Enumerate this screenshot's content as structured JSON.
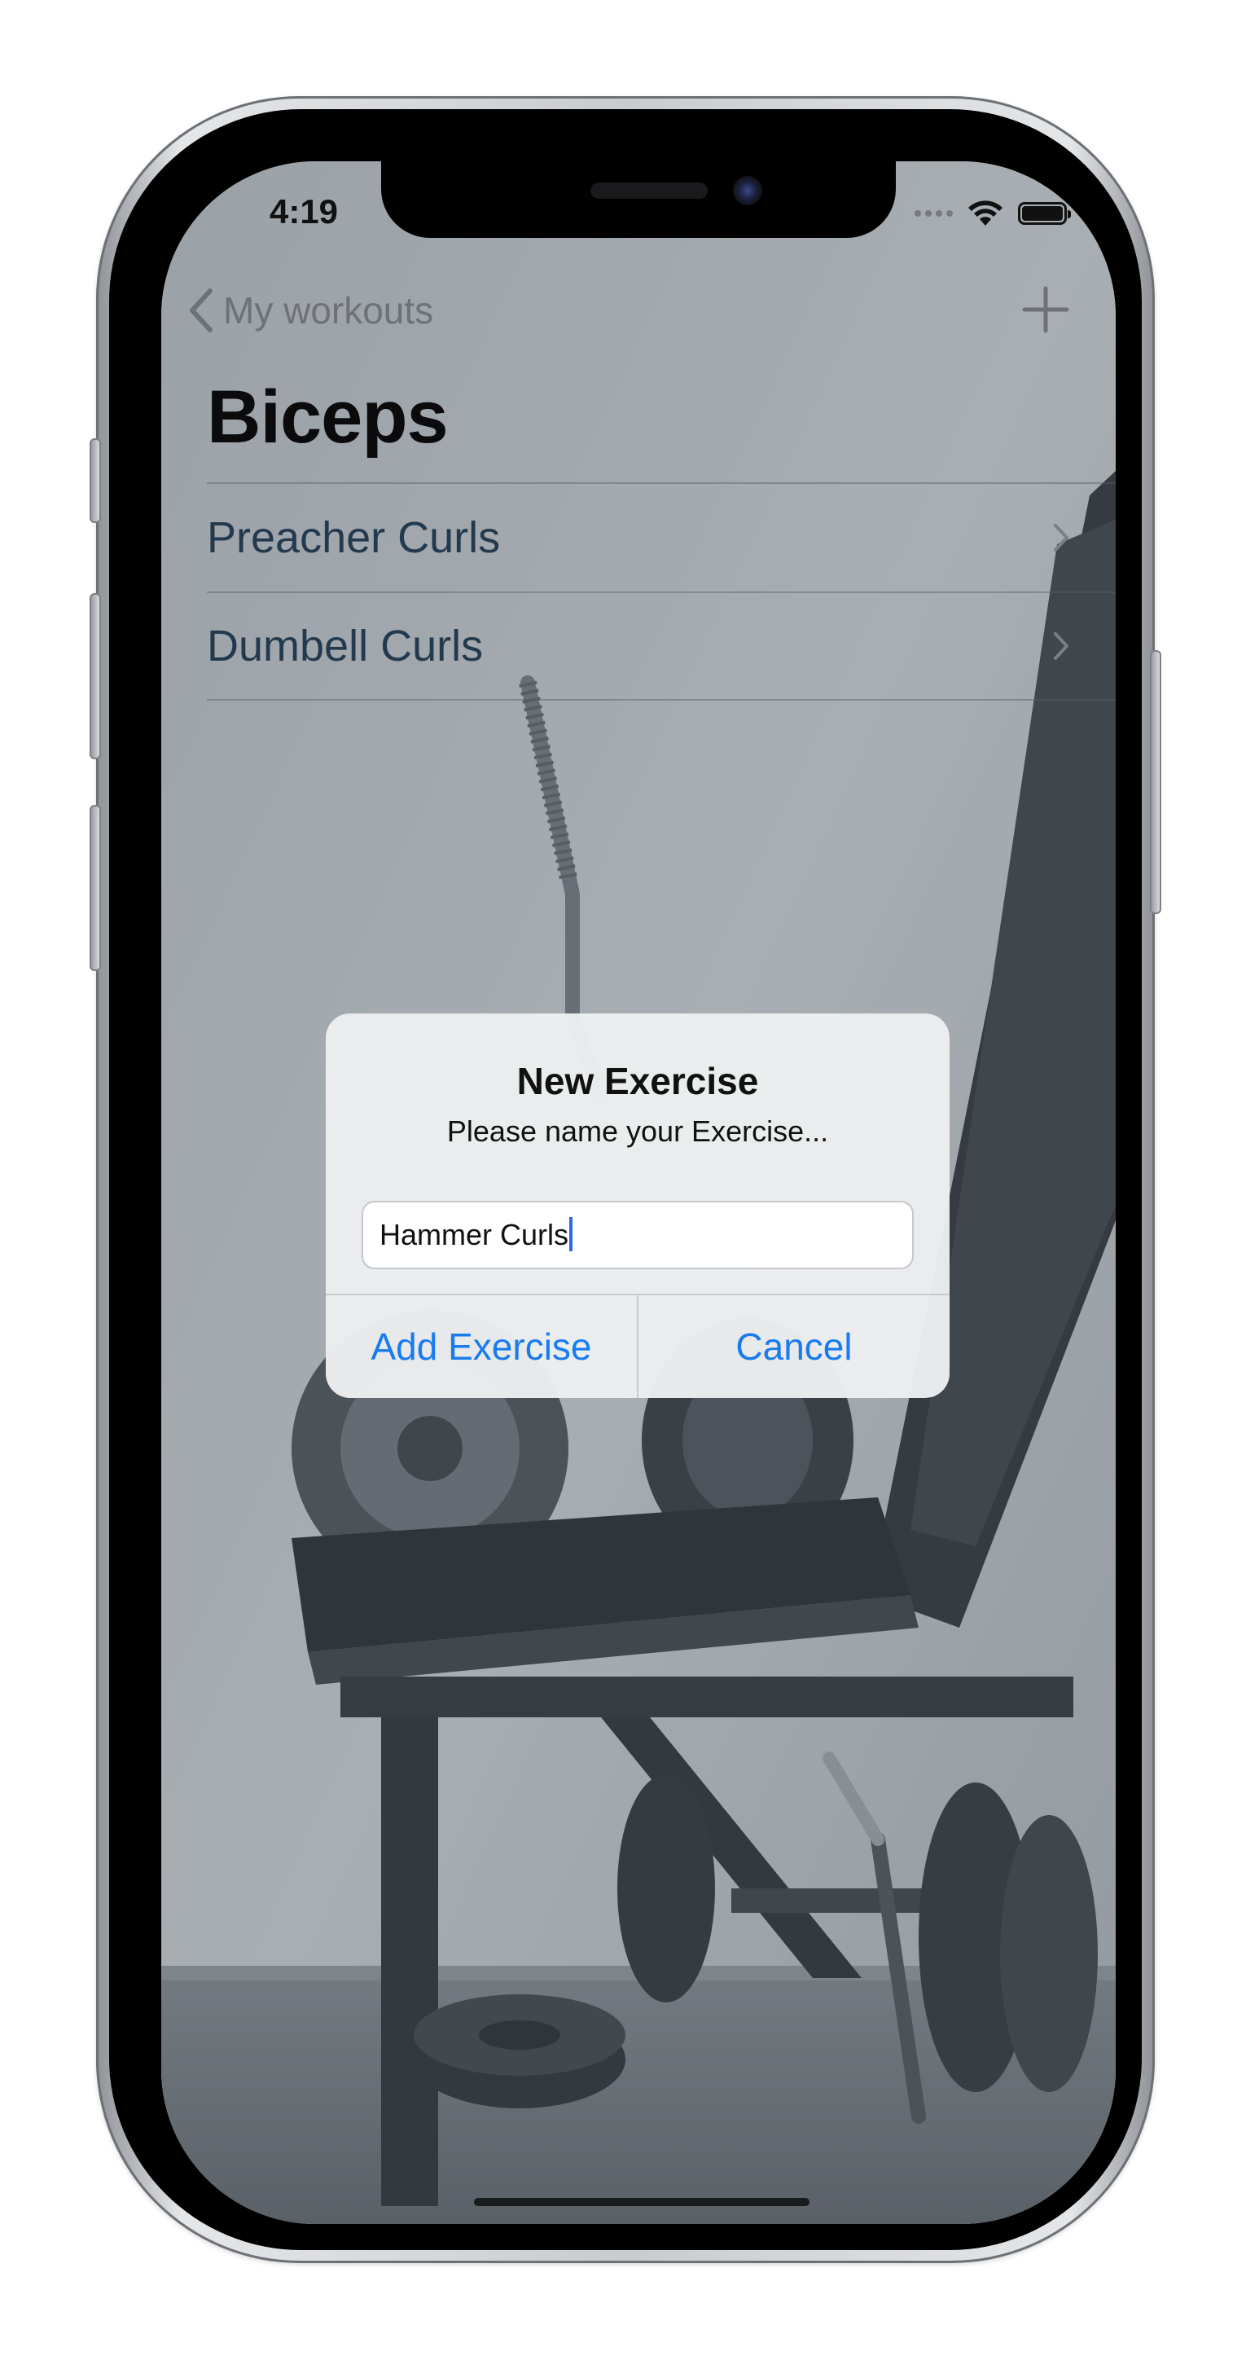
{
  "status_bar": {
    "time": "4:19"
  },
  "nav": {
    "back_label": "My workouts",
    "add_icon": "plus-icon"
  },
  "page": {
    "title": "Biceps"
  },
  "exercises": [
    {
      "label": "Preacher Curls"
    },
    {
      "label": "Dumbell Curls"
    }
  ],
  "alert": {
    "title": "New Exercise",
    "message": "Please name your Exercise...",
    "input_value": "Hammer Curls",
    "primary_label": "Add Exercise",
    "cancel_label": "Cancel"
  },
  "colors": {
    "accent": "#1a7bf0",
    "list_text": "#23394d",
    "nav_gray": "#6e7276"
  }
}
